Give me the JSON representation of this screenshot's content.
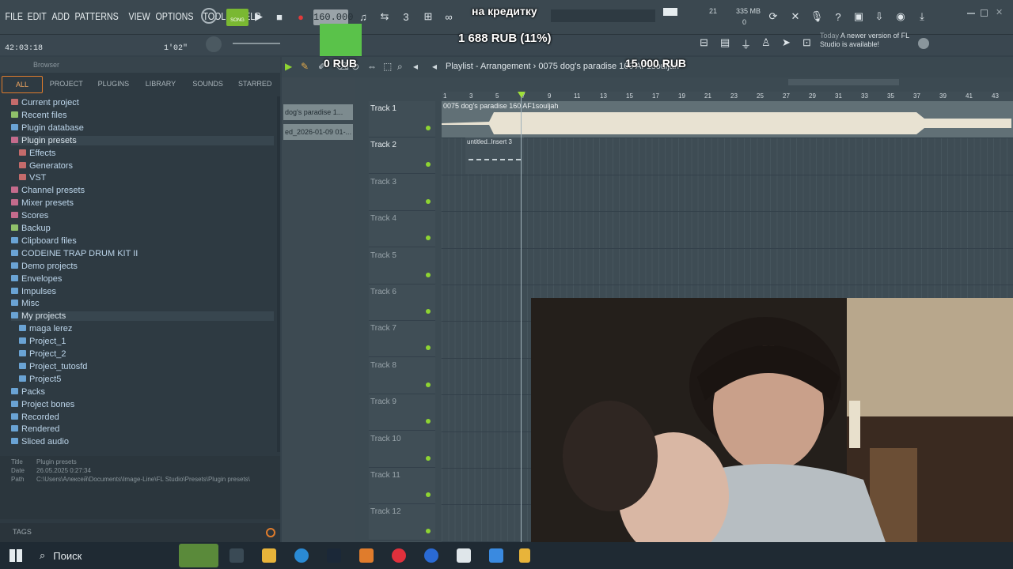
{
  "menu": {
    "items": [
      "FILE",
      "EDIT",
      "ADD",
      "PATTERNS",
      "VIEW",
      "OPTIONS",
      "TOOLS",
      "HELP"
    ]
  },
  "transport": {
    "mode": "SONG",
    "tempo": "160.000",
    "time": "42:03:18",
    "time2": "1'02\""
  },
  "overlay": {
    "label_credit": "на кредитку",
    "amount_current": "1 688 RUB (11%)",
    "amount_start": "0 RUB",
    "amount_goal": "15 000 RUB",
    "progress": 0.11
  },
  "status": {
    "cpu": "21",
    "mem": "335 MB",
    "poly": "0"
  },
  "news": {
    "label": "Today",
    "text": "A newer version of FL Studio is available!"
  },
  "browser": {
    "title": "Browser",
    "tabs": [
      "ALL",
      "PROJECT",
      "PLUGINS",
      "LIBRARY",
      "SOUNDS",
      "STARRED"
    ],
    "tree": [
      {
        "label": "Current project",
        "color": "#c46b6b",
        "indent": 0
      },
      {
        "label": "Recent files",
        "color": "#8fc06a",
        "indent": 0
      },
      {
        "label": "Plugin database",
        "color": "#6aa3d4",
        "indent": 0
      },
      {
        "label": "Plugin presets",
        "color": "#c46b8c",
        "indent": 0,
        "selected": true
      },
      {
        "label": "Effects",
        "color": "#c46b6b",
        "indent": 1
      },
      {
        "label": "Generators",
        "color": "#c46b6b",
        "indent": 1
      },
      {
        "label": "VST",
        "color": "#c46b6b",
        "indent": 1
      },
      {
        "label": "Channel presets",
        "color": "#c46b8c",
        "indent": 0
      },
      {
        "label": "Mixer presets",
        "color": "#c46b8c",
        "indent": 0
      },
      {
        "label": "Scores",
        "color": "#c46b8c",
        "indent": 0
      },
      {
        "label": "Backup",
        "color": "#8fc06a",
        "indent": 0
      },
      {
        "label": "Clipboard files",
        "color": "#6aa3d4",
        "indent": 0
      },
      {
        "label": "CODEINE TRAP DRUM KIT II",
        "color": "#6aa3d4",
        "indent": 0
      },
      {
        "label": "Demo projects",
        "color": "#6aa3d4",
        "indent": 0
      },
      {
        "label": "Envelopes",
        "color": "#6aa3d4",
        "indent": 0
      },
      {
        "label": "Impulses",
        "color": "#6aa3d4",
        "indent": 0
      },
      {
        "label": "Misc",
        "color": "#6aa3d4",
        "indent": 0
      },
      {
        "label": "My projects",
        "color": "#6aa3d4",
        "indent": 0,
        "selected": true
      },
      {
        "label": "maga lerez",
        "color": "#6aa3d4",
        "indent": 1
      },
      {
        "label": "Project_1",
        "color": "#6aa3d4",
        "indent": 1
      },
      {
        "label": "Project_2",
        "color": "#6aa3d4",
        "indent": 1
      },
      {
        "label": "Project_tutosfd",
        "color": "#6aa3d4",
        "indent": 1
      },
      {
        "label": "Project5",
        "color": "#6aa3d4",
        "indent": 1
      },
      {
        "label": "Packs",
        "color": "#6aa3d4",
        "indent": 0
      },
      {
        "label": "Project bones",
        "color": "#6aa3d4",
        "indent": 0
      },
      {
        "label": "Recorded",
        "color": "#6aa3d4",
        "indent": 0
      },
      {
        "label": "Rendered",
        "color": "#6aa3d4",
        "indent": 0
      },
      {
        "label": "Sliced audio",
        "color": "#6aa3d4",
        "indent": 0
      }
    ],
    "info": {
      "title_label": "Title",
      "title": "Plugin presets",
      "date_label": "Date",
      "date": "26.05.2025 0:27:34",
      "path_label": "Path",
      "path": "C:\\Users\\Алексей\\Documents\\Image-Line\\FL Studio\\Presets\\Plugin presets\\"
    },
    "tags_label": "TAGS"
  },
  "playlist": {
    "title": "Playlist - Arrangement",
    "breadcrumb": "0075 dog's paradise 160 AF1souljah",
    "patterns": [
      "dog's paradise 1...",
      "ed_2026-01-09 01-..."
    ],
    "tracks": [
      "Track 1",
      "Track 2",
      "Track 3",
      "Track 4",
      "Track 5",
      "Track 6",
      "Track 7",
      "Track 8",
      "Track 9",
      "Track 10",
      "Track 11",
      "Track 12"
    ],
    "ruler": [
      "1",
      "3",
      "5",
      "7",
      "9",
      "11",
      "13",
      "15",
      "17",
      "19",
      "21",
      "23",
      "25",
      "27",
      "29",
      "31",
      "33",
      "35",
      "37",
      "39",
      "41",
      "43"
    ],
    "clip1": "0075 dog's paradise 160 AF1souljah",
    "clip2": "untitled..Insert 3"
  },
  "taskbar": {
    "search": "Поиск"
  }
}
